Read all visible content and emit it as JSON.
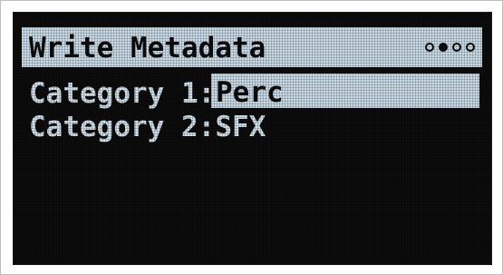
{
  "screen": {
    "title": "Write Metadata",
    "page_indicator": {
      "total": 4,
      "active_index": 1
    }
  },
  "fields": [
    {
      "label": "Category 1:",
      "value": "Perc",
      "selected": true
    },
    {
      "label": "Category 2:",
      "value": "SFX",
      "selected": false
    }
  ],
  "colors": {
    "screen_background": "#0c0c0c",
    "highlight": "#c9dae6",
    "text": "#d2e0ea",
    "highlight_text": "#0d0d0d"
  }
}
